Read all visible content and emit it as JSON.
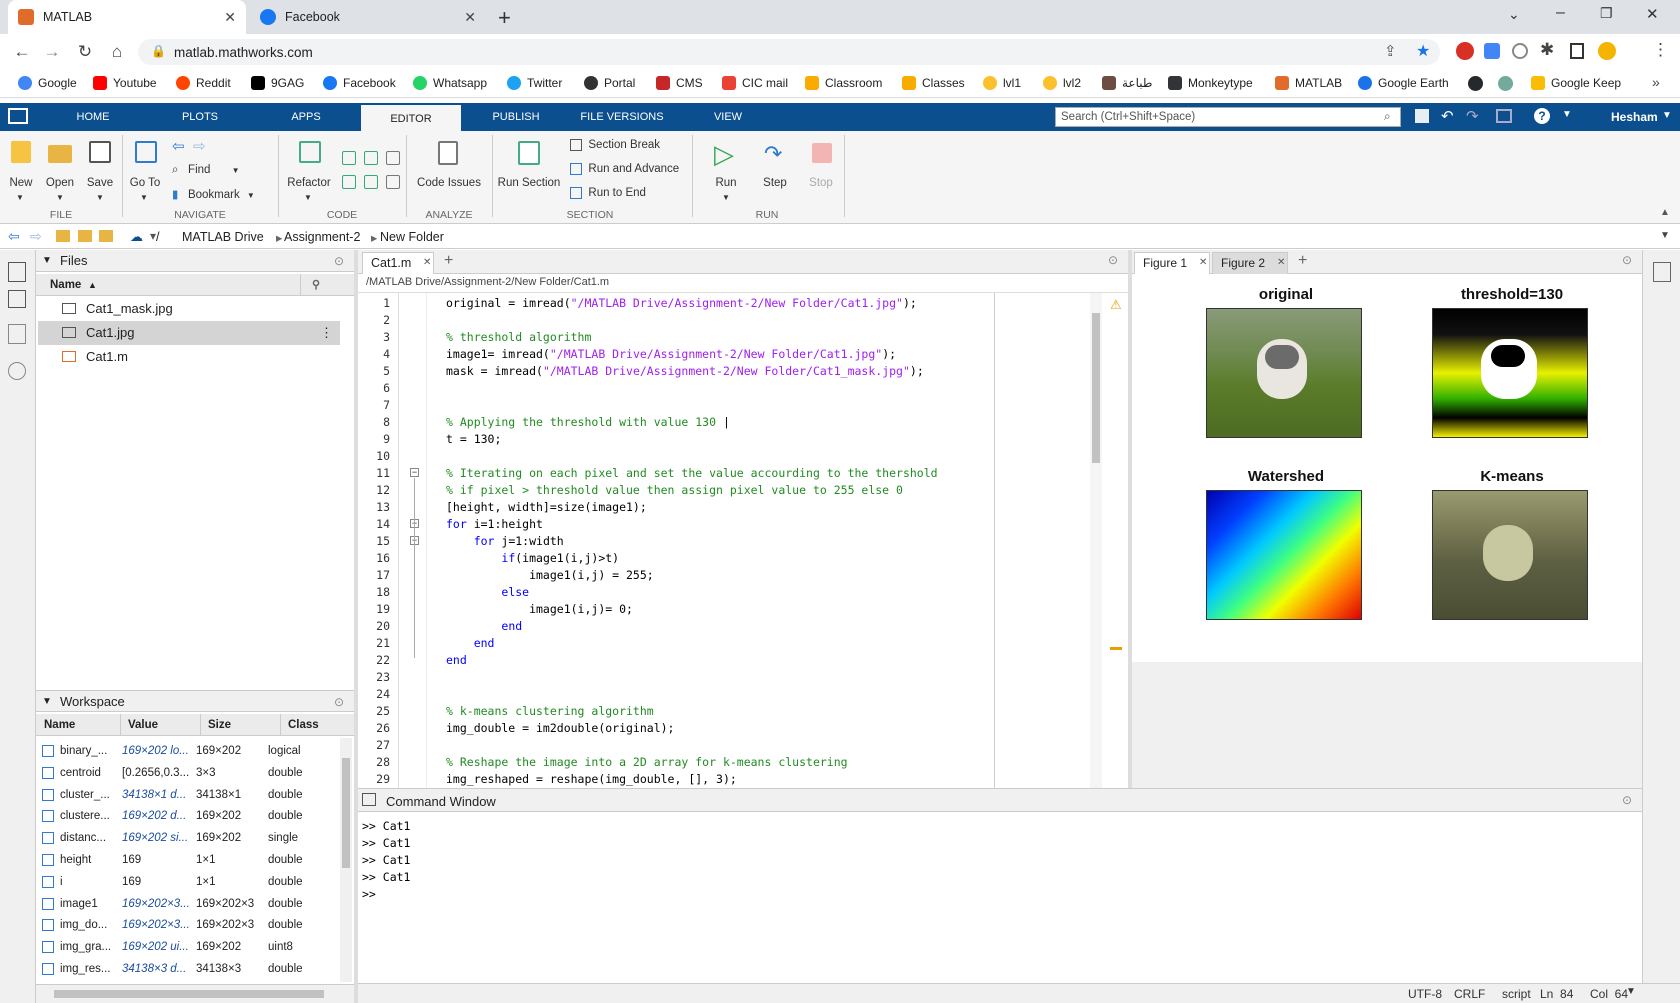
{
  "browser": {
    "tabs": [
      {
        "label": "MATLAB"
      },
      {
        "label": "Facebook"
      }
    ],
    "url": "matlab.mathworks.com",
    "bookmarks": [
      "Google",
      "Youtube",
      "Reddit",
      "9GAG",
      "Facebook",
      "Whatsapp",
      "Twitter",
      "Portal",
      "CMS",
      "CIC mail",
      "Classroom",
      "Classes",
      "lvl1",
      "lvl2",
      "طباعة",
      "Monkeytype",
      "MATLAB",
      "Google Earth",
      "Google Keep"
    ]
  },
  "toolstrip": {
    "tabs": [
      "HOME",
      "PLOTS",
      "APPS",
      "EDITOR",
      "PUBLISH",
      "FILE VERSIONS",
      "VIEW"
    ],
    "search_placeholder": "Search (Ctrl+Shift+Space)",
    "user": "Hesham",
    "file": {
      "new": "New",
      "open": "Open",
      "save": "Save",
      "group": "FILE"
    },
    "navigate": {
      "goto": "Go To",
      "find": "Find",
      "bookmark": "Bookmark",
      "group": "NAVIGATE"
    },
    "code": {
      "refactor": "Refactor",
      "group": "CODE"
    },
    "analyze": {
      "issues": "Code Issues",
      "group": "ANALYZE"
    },
    "section": {
      "run_section": "Run Section",
      "break": "Section Break",
      "run_advance": "Run and Advance",
      "run_end": "Run to End",
      "group": "SECTION"
    },
    "run": {
      "run": "Run",
      "step": "Step",
      "stop": "Stop",
      "group": "RUN"
    }
  },
  "address": {
    "root": "/",
    "items": [
      "MATLAB Drive",
      "Assignment-2",
      "New Folder"
    ]
  },
  "files": {
    "title": "Files",
    "col_name": "Name",
    "items": [
      "Cat1_mask.jpg",
      "Cat1.jpg",
      "Cat1.m"
    ]
  },
  "workspace": {
    "title": "Workspace",
    "cols": [
      "Name",
      "Value",
      "Size",
      "Class"
    ],
    "rows": [
      [
        "binary_...",
        "169×202 lo...",
        "169×202",
        "logical"
      ],
      [
        "centroid",
        "[0.2656,0.3...",
        "3×3",
        "double"
      ],
      [
        "cluster_...",
        "34138×1 d...",
        "34138×1",
        "double"
      ],
      [
        "clustere...",
        "169×202 d...",
        "169×202",
        "double"
      ],
      [
        "distanc...",
        "169×202 si...",
        "169×202",
        "single"
      ],
      [
        "height",
        "169",
        "1×1",
        "double"
      ],
      [
        "i",
        "169",
        "1×1",
        "double"
      ],
      [
        "image1",
        "169×202×3...",
        "169×202×3",
        "double"
      ],
      [
        "img_do...",
        "169×202×3...",
        "169×202×3",
        "double"
      ],
      [
        "img_gra...",
        "169×202 ui...",
        "169×202",
        "uint8"
      ],
      [
        "img_res...",
        "34138×3 d...",
        "34138×3",
        "double"
      ]
    ]
  },
  "editor": {
    "tab": "Cat1.m",
    "path": "/MATLAB Drive/Assignment-2/New Folder/Cat1.m"
  },
  "figures": {
    "tabs": [
      "Figure 1",
      "Figure 2"
    ],
    "titles": [
      "original",
      "threshold=130",
      "Watershed",
      "K-means"
    ]
  },
  "command": {
    "title": "Command Window",
    "lines": [
      ">> Cat1",
      ">> Cat1",
      ">> Cat1",
      ">> Cat1",
      ">>"
    ]
  },
  "status": {
    "encoding": "UTF-8",
    "eol": "CRLF",
    "type": "script",
    "ln": "Ln  84",
    "col": "Col  64"
  }
}
